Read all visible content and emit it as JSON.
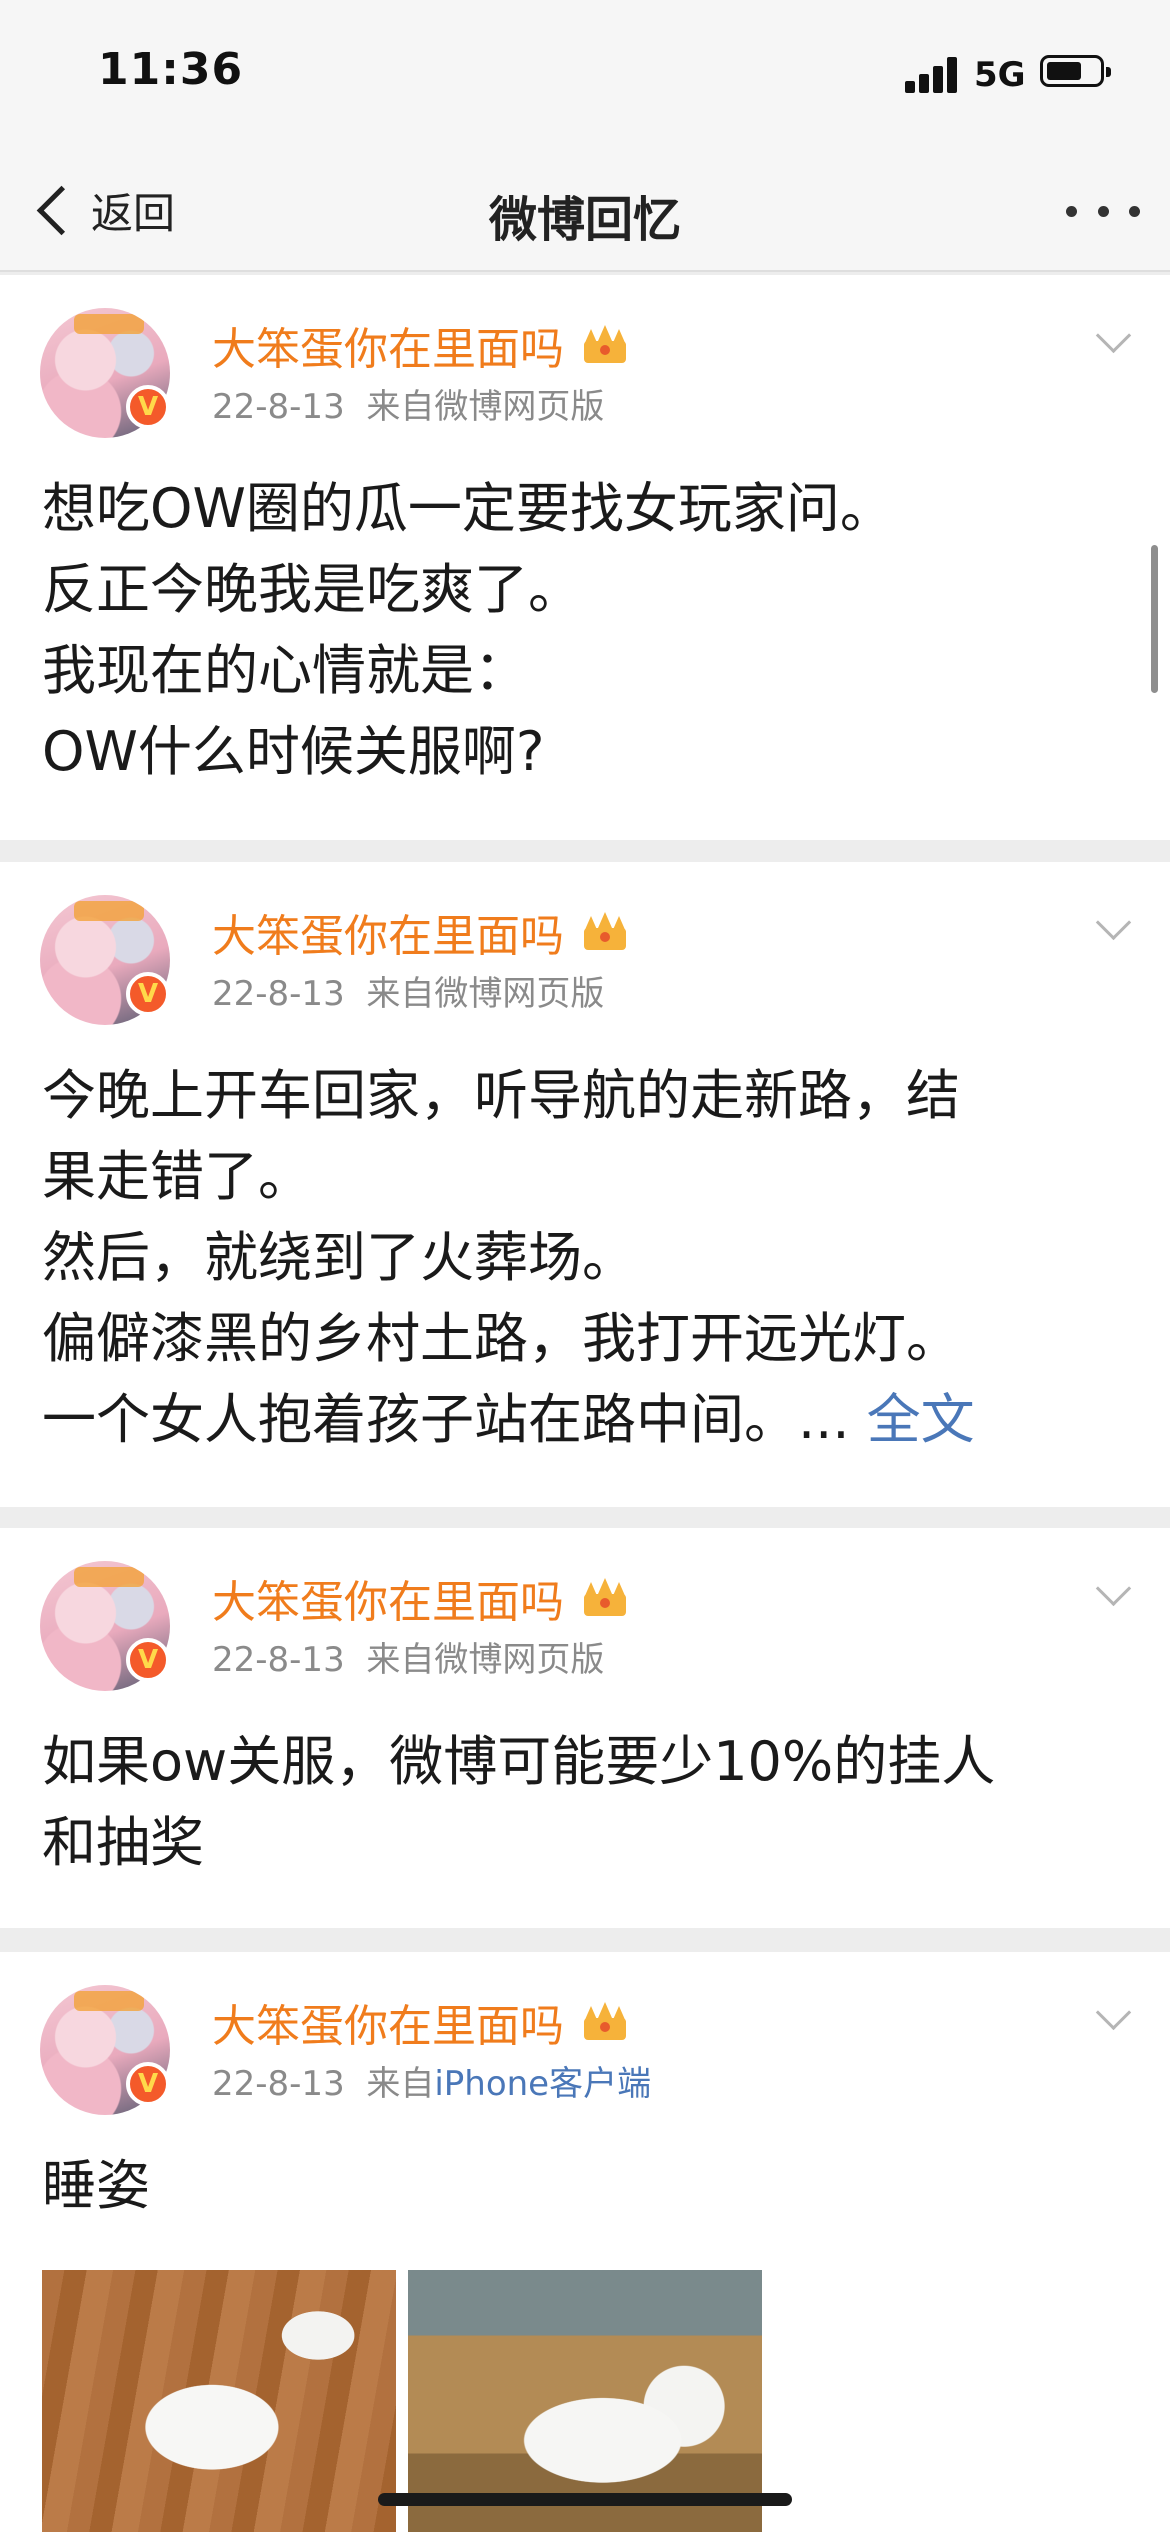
{
  "status_bar": {
    "time": "11:36",
    "network": "5G"
  },
  "nav": {
    "back_label": "返回",
    "title": "微博回忆"
  },
  "posts": [
    {
      "username": "大笨蛋你在里面吗",
      "date": "22-8-13",
      "source_prefix": "来自",
      "source": "微博网页版",
      "lines": [
        "想吃OW圈的瓜一定要找女玩家问。",
        "反正今晚我是吃爽了。",
        "我现在的心情就是：",
        "OW什么时候关服啊?"
      ]
    },
    {
      "username": "大笨蛋你在里面吗",
      "date": "22-8-13",
      "source_prefix": "来自",
      "source": "微博网页版",
      "lines": [
        "今晚上开车回家，听导航的走新路，结",
        "果走错了。",
        "然后，就绕到了火葬场。",
        "偏僻漆黑的乡村土路，我打开远光灯。",
        "一个女人抱着孩子站在路中间。..."
      ],
      "full_text_label": "全文"
    },
    {
      "username": "大笨蛋你在里面吗",
      "date": "22-8-13",
      "source_prefix": "来自",
      "source": "微博网页版",
      "lines": [
        "如果ow关服，微博可能要少10%的挂人",
        "和抽奖"
      ]
    },
    {
      "username": "大笨蛋你在里面吗",
      "date": "22-8-13",
      "source_prefix": "来自",
      "source": "iPhone客户端",
      "lines": [
        "睡姿"
      ]
    }
  ],
  "icons": {
    "verified_badge": "V",
    "vip_crown": "crown-icon",
    "more": "more-dots-icon",
    "expand": "chevron-down-icon",
    "back": "chevron-left-icon"
  },
  "colors": {
    "username": "#f07c1c",
    "link": "#4a77b8",
    "meta": "#8a8a8a",
    "background": "#ededed"
  }
}
